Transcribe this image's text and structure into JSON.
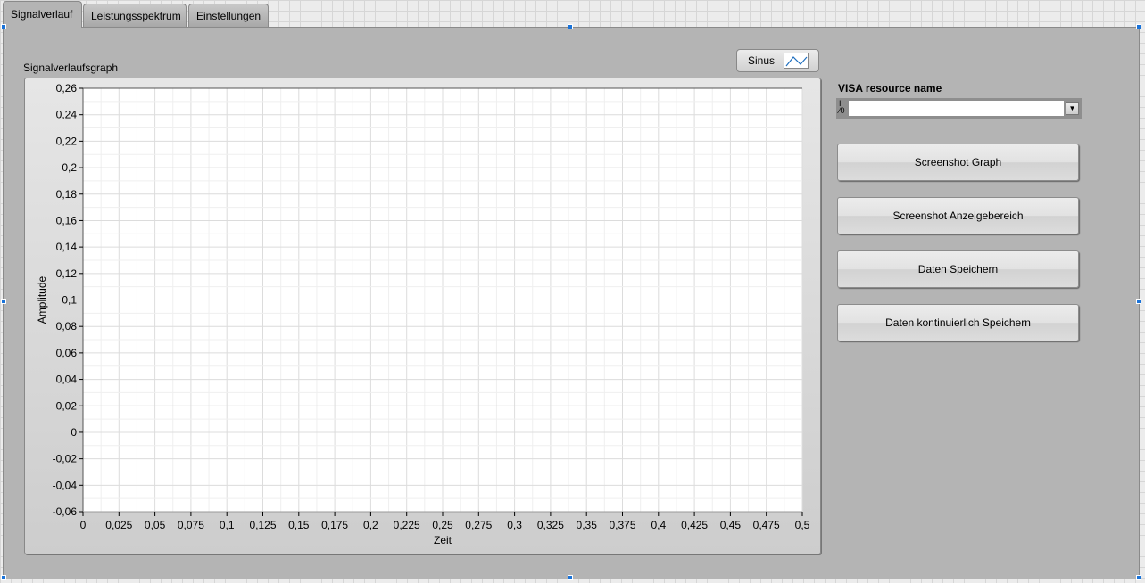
{
  "tabs": [
    {
      "label": "Signalverlauf",
      "active": true
    },
    {
      "label": "Leistungsspektrum"
    },
    {
      "label": "Einstellungen"
    }
  ],
  "graph": {
    "label": "Signalverlaufsgraph",
    "legend": {
      "label": "Sinus",
      "color": "#1f6fbf"
    }
  },
  "visa": {
    "label": "VISA resource name",
    "value": "",
    "io_icon": "I/0"
  },
  "buttons": [
    "Screenshot Graph",
    "Screenshot Anzeigebereich",
    "Daten Speichern",
    "Daten kontinuierlich Speichern"
  ],
  "chart_data": {
    "type": "line",
    "title": "Signalverlaufsgraph",
    "xlabel": "Zeit",
    "ylabel": "Amplitude",
    "xlim": [
      0,
      0.5
    ],
    "ylim": [
      -0.06,
      0.26
    ],
    "xticks": [
      "0",
      "0,025",
      "0,05",
      "0,075",
      "0,1",
      "0,125",
      "0,15",
      "0,175",
      "0,2",
      "0,225",
      "0,25",
      "0,275",
      "0,3",
      "0,325",
      "0,35",
      "0,375",
      "0,4",
      "0,425",
      "0,45",
      "0,475",
      "0,5"
    ],
    "yticks": [
      "0,26",
      "0,24",
      "0,22",
      "0,2",
      "0,18",
      "0,16",
      "0,14",
      "0,12",
      "0,1",
      "0,08",
      "0,06",
      "0,04",
      "0,02",
      "0",
      "-0,02",
      "-0,04",
      "-0,06"
    ],
    "grid": true,
    "series": [
      {
        "name": "Sinus",
        "x": [],
        "y": []
      }
    ]
  }
}
